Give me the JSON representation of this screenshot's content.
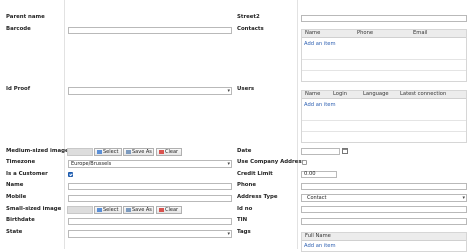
{
  "left": {
    "parent_name": "Parent name",
    "barcode": "Barcode",
    "id_proof": "Id Proof",
    "medium_image": "Medium-sized image",
    "timezone": "Timezone",
    "timezone_value": "Europe/Brussels",
    "is_customer": "Is a Customer",
    "name": "Name",
    "mobile": "Mobile",
    "small_image": "Small-sized image",
    "birthdate": "Birthdate",
    "state": "State"
  },
  "right": {
    "street2": "Street2",
    "contacts": "Contacts",
    "users": "Users",
    "date": "Date",
    "use_company_address": "Use Company Address",
    "credit_limit": "Credit Limit",
    "credit_limit_value": "0.00",
    "phone": "Phone",
    "address_type": "Address Type",
    "address_type_value": "Contact",
    "id_no": "Id no",
    "tin": "TIN",
    "tags": "Tags"
  },
  "buttons": {
    "select": "Select",
    "save_as": "Save As",
    "clear": "Clear"
  },
  "contacts_grid": {
    "columns": [
      "Name",
      "Phone",
      "Email"
    ],
    "add": "Add an item"
  },
  "users_grid": {
    "columns": [
      "Name",
      "Login",
      "Language",
      "Latest connection"
    ],
    "add": "Add an item"
  },
  "bottom_grid": {
    "columns": [
      "Full Name"
    ],
    "add": "Add an item"
  },
  "is_customer_checked": true,
  "use_company_address_checked": false
}
